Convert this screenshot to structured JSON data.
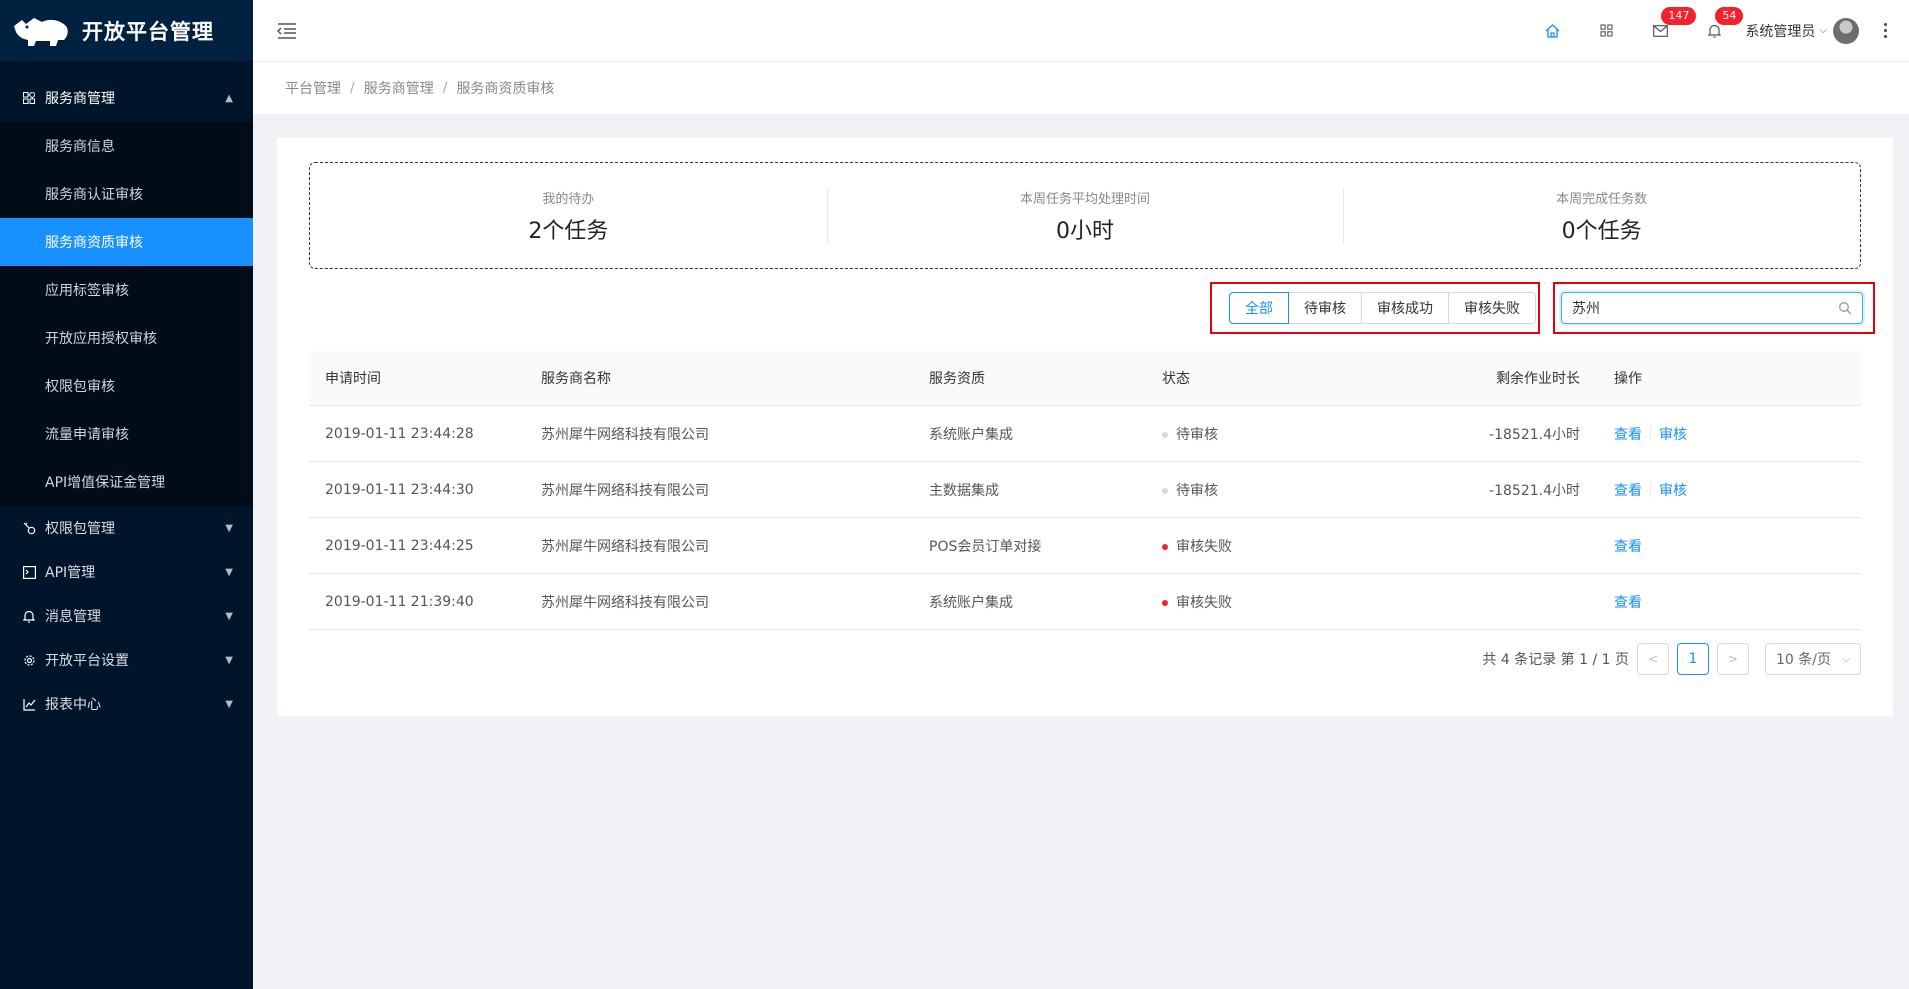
{
  "app": {
    "title": "开放平台管理"
  },
  "sidebar": {
    "groups": [
      {
        "label": "服务商管理",
        "icon": "apps-icon",
        "expanded": true,
        "items": [
          {
            "label": "服务商信息"
          },
          {
            "label": "服务商认证审核"
          },
          {
            "label": "服务商资质审核",
            "active": true
          },
          {
            "label": "应用标签审核"
          },
          {
            "label": "开放应用授权审核"
          },
          {
            "label": "权限包审核"
          },
          {
            "label": "流量申请审核"
          },
          {
            "label": "API增值保证金管理"
          }
        ]
      }
    ],
    "menu": [
      {
        "label": "权限包管理",
        "icon": "key-icon"
      },
      {
        "label": "API管理",
        "icon": "code-icon"
      },
      {
        "label": "消息管理",
        "icon": "bell-icon"
      },
      {
        "label": "开放平台设置",
        "icon": "gear-icon"
      },
      {
        "label": "报表中心",
        "icon": "line-chart-icon"
      }
    ]
  },
  "header": {
    "mail_badge": "147",
    "notice_badge": "54",
    "user_name": "系统管理员"
  },
  "breadcrumb": [
    "平台管理",
    "服务商管理",
    "服务商资质审核"
  ],
  "stats": [
    {
      "label": "我的待办",
      "value": "2个任务"
    },
    {
      "label": "本周任务平均处理时间",
      "value": "0小时"
    },
    {
      "label": "本周完成任务数",
      "value": "0个任务"
    }
  ],
  "filters": {
    "options": [
      "全部",
      "待审核",
      "审核成功",
      "审核失败"
    ],
    "selected": "全部"
  },
  "search": {
    "value": "苏州"
  },
  "table": {
    "columns": [
      "申请时间",
      "服务商名称",
      "服务资质",
      "状态",
      "剩余作业时长",
      "操作"
    ],
    "rows": [
      {
        "time": "2019-01-11 23:44:28",
        "name": "苏州犀牛网络科技有限公司",
        "qual": "系统账户集成",
        "status": "待审核",
        "status_color": "#d9d9d9",
        "remaining": "-18521.4小时",
        "actions": [
          "查看",
          "审核"
        ]
      },
      {
        "time": "2019-01-11 23:44:30",
        "name": "苏州犀牛网络科技有限公司",
        "qual": "主数据集成",
        "status": "待审核",
        "status_color": "#d9d9d9",
        "remaining": "-18521.4小时",
        "actions": [
          "查看",
          "审核"
        ]
      },
      {
        "time": "2019-01-11 23:44:25",
        "name": "苏州犀牛网络科技有限公司",
        "qual": "POS会员订单对接",
        "status": "审核失败",
        "status_color": "#f5222d",
        "remaining": "",
        "actions": [
          "查看"
        ]
      },
      {
        "time": "2019-01-11 21:39:40",
        "name": "苏州犀牛网络科技有限公司",
        "qual": "系统账户集成",
        "status": "审核失败",
        "status_color": "#f5222d",
        "remaining": "",
        "actions": [
          "查看"
        ]
      }
    ]
  },
  "pagination": {
    "summary": "共 4 条记录 第 1 / 1 页",
    "current": "1",
    "page_size": "10 条/页"
  },
  "colors": {
    "primary": "#1890ff",
    "sidebar": "#001529",
    "highlight_border": "#e60012"
  }
}
